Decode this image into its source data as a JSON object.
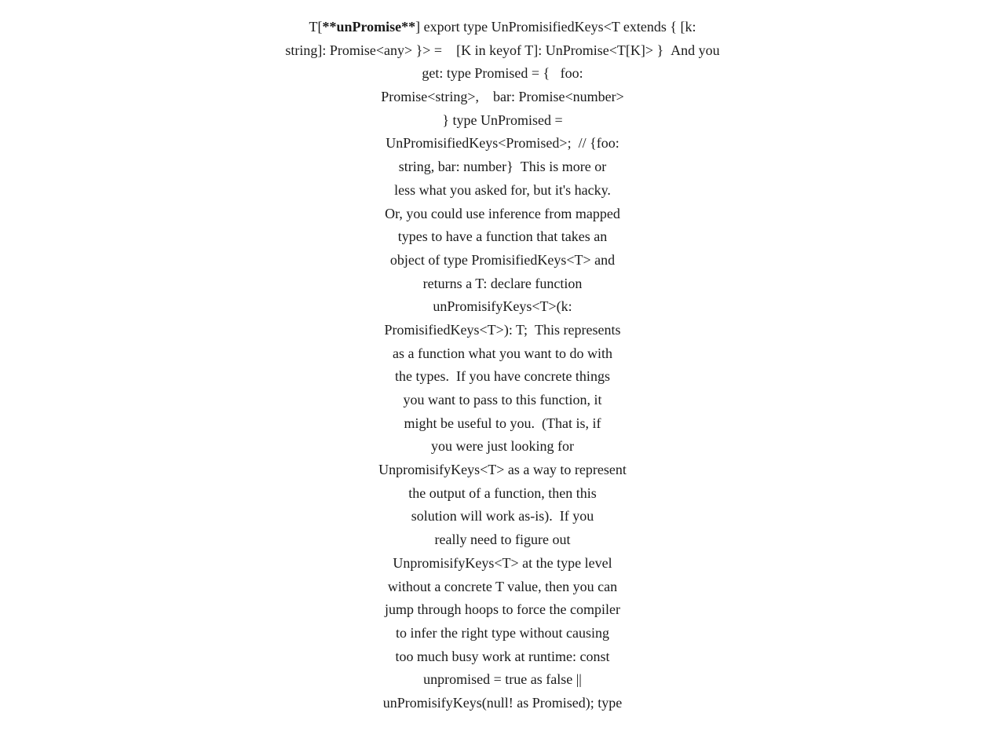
{
  "content": {
    "paragraphs": [
      {
        "id": "p1",
        "html": "T[**unPromise**] export type UnPromisifiedKeys&lt;T extends { [k: string]: Promise&lt;any&gt; }&gt; =  &nbsp;&nbsp;&nbsp;[K in keyof T]: UnPromise&lt;T[K]&gt; }  And you get: type Promised = {  &nbsp; foo: Promise&lt;string&gt;,  &nbsp; bar: Promise&lt;number&gt; } type UnPromised = UnPromisifiedKeys&lt;Promised&gt;;  // {foo: string, bar: number}  This is more or less what you asked for, but it's hacky.  Or, you could use inference from mapped types to have a function that takes an object of type PromisifiedKeys&lt;T&gt; and returns a T: declare function unPromisifyKeys&lt;T&gt;(k: PromisifiedKeys&lt;T&gt;): T;  This represents as a function what you want to do with the types.  If you have concrete things you want to pass to this function, it might be useful to you.  (That is, if you were just looking for UnpromisifyKeys&lt;T&gt; as a way to represent the output of a function, then this solution will work as-is).  If you really need to figure out UnpromisifyKeys&lt;T&gt; at the type level without a concrete T value, then you can jump through hoops to force the compiler to infer the right type without causing too much busy work at runtime: const unpromised = true as false || unPromisifyKeys(null! as Promised); type"
      }
    ]
  }
}
